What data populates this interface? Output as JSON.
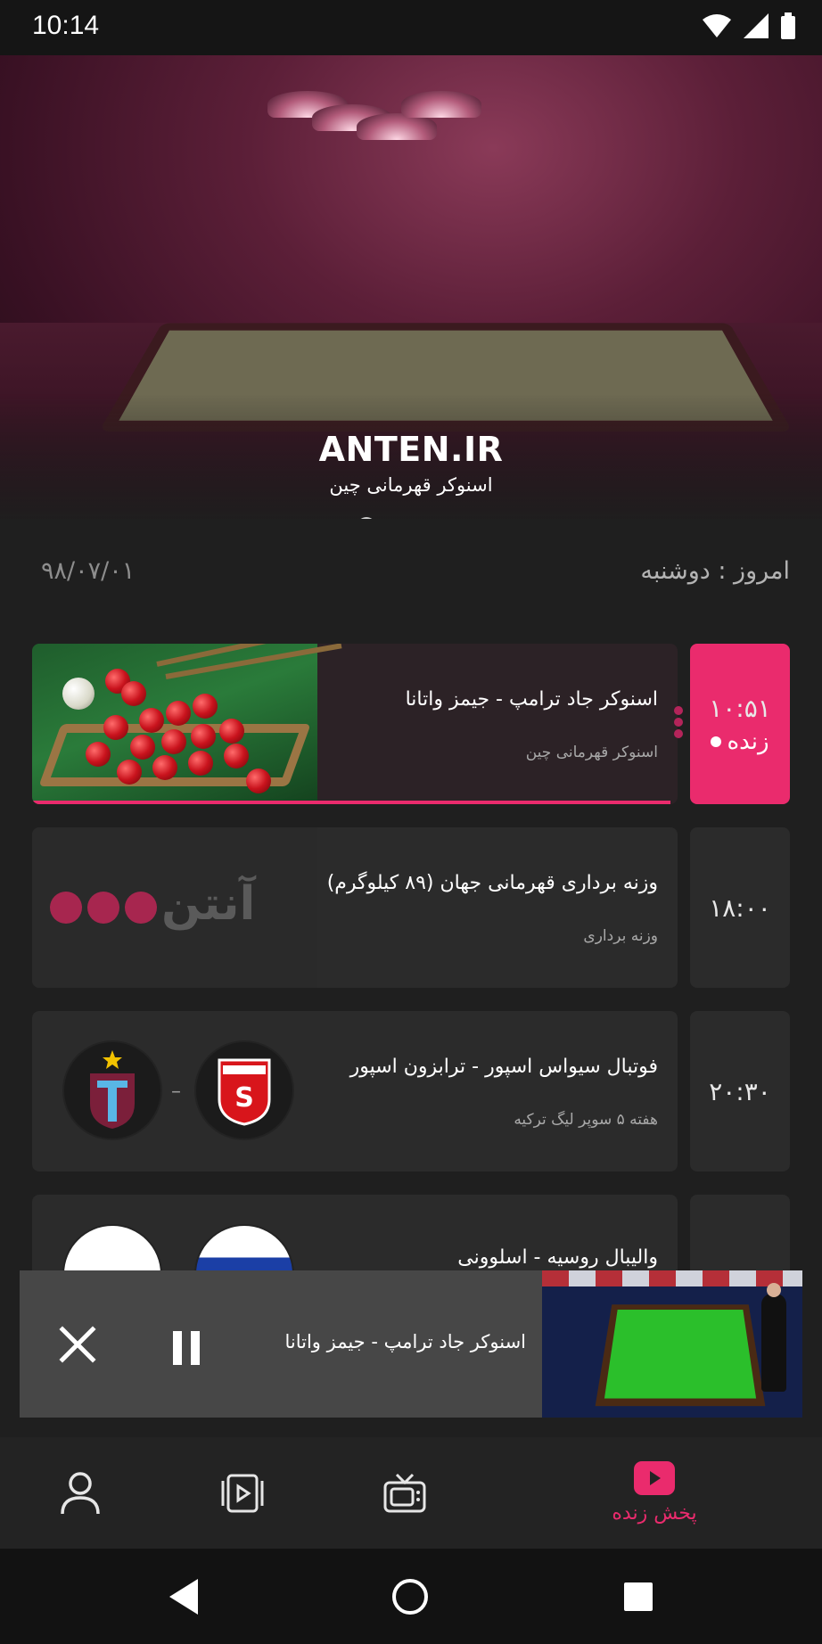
{
  "status_bar": {
    "time": "10:14"
  },
  "hero": {
    "brand": "ANTEN.IR",
    "subtitle": "اسنوکر قهرمانی چین",
    "slides": 5,
    "active_slide": 1
  },
  "schedule": {
    "today_label": "امروز : دوشنبه",
    "date": "۹۸/۰۷/۰۱",
    "programs": [
      {
        "time": "۱۰:۵۱",
        "live_label": "زنده",
        "title": "اسنوکر جاد ترامپ - جیمز واتانا",
        "category": "اسنوکر قهرمانی چین"
      },
      {
        "time": "۱۸:۰۰",
        "title": "وزنه برداری قهرمانی جهان (۸۹ کیلوگرم)",
        "category": "وزنه برداری",
        "thumb_word": "آنتن"
      },
      {
        "time": "۲۰:۳۰",
        "title": "فوتبال سیواس اسپور - ترابزون اسپور",
        "category": "هفته ۵ سوپر لیگ ترکیه",
        "vs": "–"
      },
      {
        "title": "والیبال روسیه - اسلوونی"
      }
    ]
  },
  "mini_player": {
    "title": "اسنوکر جاد ترامپ - جیمز واتانا"
  },
  "bottom_nav": {
    "live_label": "پخش زنده",
    "items": [
      "profile-icon",
      "video-library-icon",
      "tv-icon",
      "live-play-icon"
    ]
  },
  "colors": {
    "accent": "#ea2b6d",
    "background": "#1f1f1f",
    "card": "#2b2b2b"
  }
}
